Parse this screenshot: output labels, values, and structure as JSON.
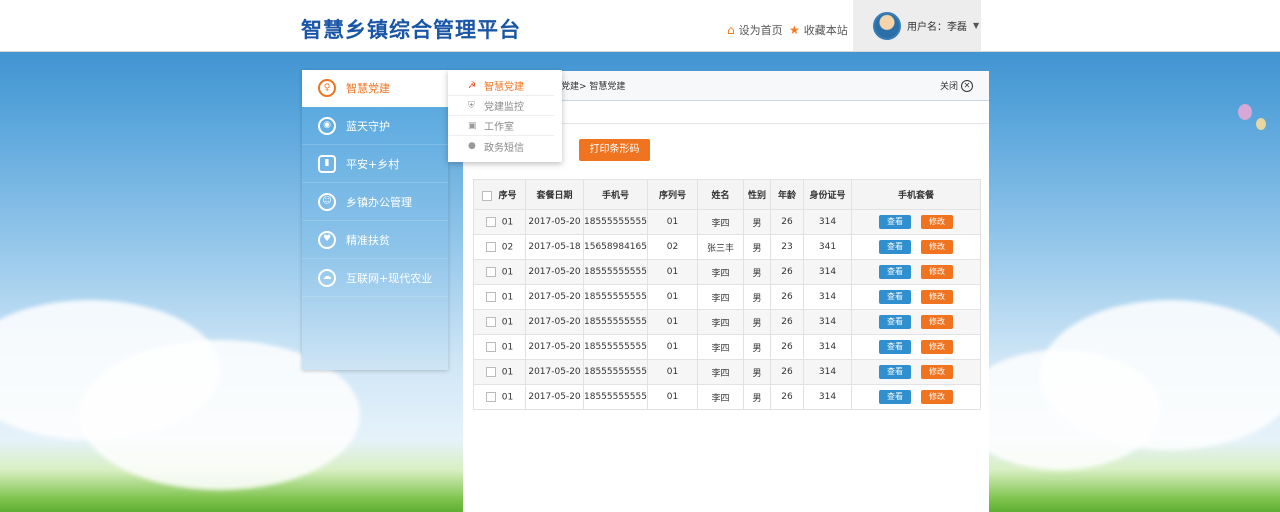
{
  "app": {
    "title": "智慧乡镇综合管理平台"
  },
  "header": {
    "home_label": "设为首页",
    "fav_label": "收藏本站",
    "user_label": "用户名：李磊"
  },
  "sidebar": {
    "items": [
      {
        "label": "智慧党建",
        "icon": "lightbulb-icon"
      },
      {
        "label": "蓝天守护",
        "icon": "camera-icon"
      },
      {
        "label": "平安+乡村",
        "icon": "mic-icon"
      },
      {
        "label": "乡镇办公管理",
        "icon": "people-icon"
      },
      {
        "label": "精准扶贫",
        "icon": "heart-hand-icon"
      },
      {
        "label": "互联网+现代农业",
        "icon": "cloud-icon"
      }
    ]
  },
  "submenu": {
    "items": [
      {
        "label": "智慧党建"
      },
      {
        "label": "党建监控"
      },
      {
        "label": "工作室"
      },
      {
        "label": "政务短信"
      }
    ]
  },
  "breadcrumb": {
    "text": "党建>  智慧党建"
  },
  "close_label": "关闭",
  "print_label": "打印条形码",
  "table": {
    "headers": [
      "序号",
      "套餐日期",
      "手机号",
      "序列号",
      "姓名",
      "性别",
      "年龄",
      "身份证号",
      "手机套餐"
    ],
    "view_label": "查看",
    "edit_label": "修改",
    "rows": [
      [
        "01",
        "2017-05-20",
        "18555555555",
        "01",
        "李四",
        "男",
        "26",
        "314"
      ],
      [
        "02",
        "2017-05-18",
        "15658984165",
        "02",
        "张三丰",
        "男",
        "23",
        "341"
      ],
      [
        "01",
        "2017-05-20",
        "18555555555",
        "01",
        "李四",
        "男",
        "26",
        "314"
      ],
      [
        "01",
        "2017-05-20",
        "18555555555",
        "01",
        "李四",
        "男",
        "26",
        "314"
      ],
      [
        "01",
        "2017-05-20",
        "18555555555",
        "01",
        "李四",
        "男",
        "26",
        "314"
      ],
      [
        "01",
        "2017-05-20",
        "18555555555",
        "01",
        "李四",
        "男",
        "26",
        "314"
      ],
      [
        "01",
        "2017-05-20",
        "18555555555",
        "01",
        "李四",
        "男",
        "26",
        "314"
      ],
      [
        "01",
        "2017-05-20",
        "18555555555",
        "01",
        "李四",
        "男",
        "26",
        "314"
      ]
    ]
  }
}
